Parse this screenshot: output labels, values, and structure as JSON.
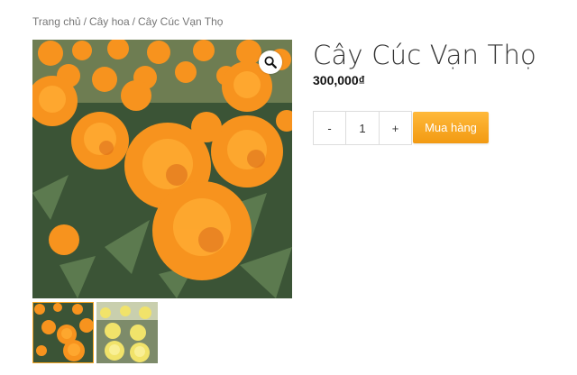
{
  "breadcrumb": {
    "home": "Trang chủ",
    "separator": "/",
    "category": "Cây hoa",
    "current": "Cây Cúc Vạn Thọ"
  },
  "product": {
    "title": "Cây Cúc Vạn Thọ",
    "price": "300,000₫",
    "quantity": "1",
    "minus_label": "-",
    "plus_label": "+",
    "buy_label": "Mua hàng"
  },
  "gallery": {
    "main_image": "orange-marigold-flowers",
    "zoom_icon": "magnifier-icon",
    "thumbnails": [
      "orange-marigold-flowers",
      "yellow-marigold-flowers"
    ]
  },
  "colors": {
    "accent": "#f5a623",
    "flower_orange": "#f7931e",
    "flower_yellow": "#f1e36a",
    "leaf_green": "#3e5a38"
  }
}
